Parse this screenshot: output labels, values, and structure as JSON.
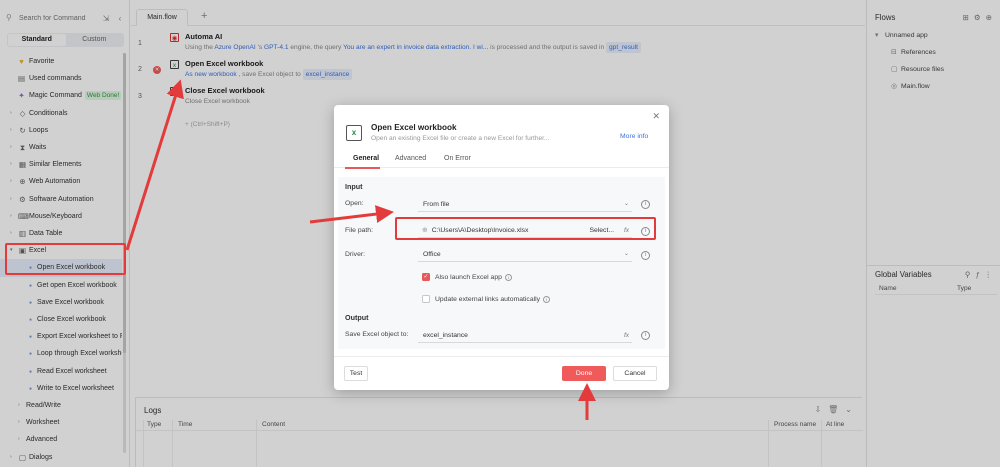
{
  "sidebar": {
    "search_placeholder": "Search for Command",
    "tab_standard": "Standard",
    "tab_custom": "Custom",
    "items": [
      {
        "label": "Favorite",
        "icon": "♥"
      },
      {
        "label": "Used commands",
        "icon": "▤"
      },
      {
        "label": "Magic Command",
        "icon": "✦",
        "badge": "Web Done!"
      },
      {
        "label": "Conditionals",
        "icon": "◇"
      },
      {
        "label": "Loops",
        "icon": "↻"
      },
      {
        "label": "Waits",
        "icon": "⧗"
      },
      {
        "label": "Similar Elements",
        "icon": "▦"
      },
      {
        "label": "Web Automation",
        "icon": "⊕"
      },
      {
        "label": "Software Automation",
        "icon": "⚙"
      },
      {
        "label": "Mouse/Keyboard",
        "icon": "⌨"
      },
      {
        "label": "Data Table",
        "icon": "▥"
      },
      {
        "label": "Excel",
        "icon": "▣"
      }
    ],
    "excel_children": [
      "Open Excel workbook",
      "Get open Excel workbook",
      "Save Excel workbook",
      "Close Excel workbook",
      "Export Excel worksheet to PD",
      "Loop through Excel workshe",
      "Read Excel worksheet",
      "Write to Excel worksheet"
    ],
    "excel_groups": [
      "Read/Write",
      "Worksheet",
      "Advanced"
    ],
    "after": [
      {
        "label": "Dialogs",
        "icon": "▢"
      }
    ]
  },
  "editor": {
    "tab_label": "Main.flow",
    "add_tab": "+",
    "steps": [
      {
        "line": "1",
        "title": "Automa AI",
        "desc_parts": [
          {
            "t": "Using the ",
            "c": "gray"
          },
          {
            "t": "Azure OpenAI",
            "c": "blue"
          },
          {
            "t": " 's ",
            "c": "gray"
          },
          {
            "t": "GPT-4.1",
            "c": "blue"
          },
          {
            "t": " engine, the query ",
            "c": "gray"
          },
          {
            "t": "You are an expert in invoice data extraction. I wi...",
            "c": "blue"
          },
          {
            "t": " is processed and the output is saved in ",
            "c": "gray"
          },
          {
            "t": "gpt_result",
            "c": "chip"
          }
        ]
      },
      {
        "line": "2",
        "title": "Open Excel workbook",
        "desc_parts": [
          {
            "t": "As new workbook",
            "c": "blue"
          },
          {
            "t": " , save Excel object to ",
            "c": "gray"
          },
          {
            "t": "excel_instance",
            "c": "chip"
          }
        ]
      },
      {
        "line": "3",
        "title": "Close Excel workbook",
        "desc_parts": [
          {
            "t": "Close Excel workbook",
            "c": "gray"
          }
        ]
      }
    ],
    "add_hint": "+ (Ctrl+Shift+P)"
  },
  "logs": {
    "title": "Logs",
    "columns": [
      "Type",
      "Time",
      "Content",
      "Process name",
      "At line"
    ]
  },
  "right_panel": {
    "flows_title": "Flows",
    "tree": [
      {
        "label": "Unnamed app",
        "level": 0
      },
      {
        "label": "References",
        "level": 1
      },
      {
        "label": "Resource files",
        "level": 1
      },
      {
        "label": "Main.flow",
        "level": 1
      }
    ],
    "gv_title": "Global Variables",
    "gv_columns": [
      "Name",
      "Type"
    ]
  },
  "dialog": {
    "title": "Open Excel workbook",
    "subtitle": "Open an existing Excel file or create a new Excel for further...",
    "more_info": "More info",
    "tabs": [
      "General",
      "Advanced",
      "On Error"
    ],
    "input_section": "Input",
    "open_label": "Open:",
    "open_value": "From file",
    "file_path_label": "File path:",
    "file_path_value": "C:\\Users\\A\\Desktop\\Invoice.xlsx",
    "select_label": "Select...",
    "fx": "fx",
    "driver_label": "Driver:",
    "driver_value": "Office",
    "check_launch": "Also launch Excel app",
    "check_launch_on": true,
    "check_update": "Update external links automatically",
    "check_update_on": false,
    "output_section": "Output",
    "save_label": "Save Excel object to:",
    "save_value": "excel_instance",
    "btn_test": "Test",
    "btn_done": "Done",
    "btn_cancel": "Cancel"
  },
  "colors": {
    "accent_red": "#e33b3b",
    "link_blue": "#3b73e0",
    "badge_green": "#2e9b42"
  }
}
